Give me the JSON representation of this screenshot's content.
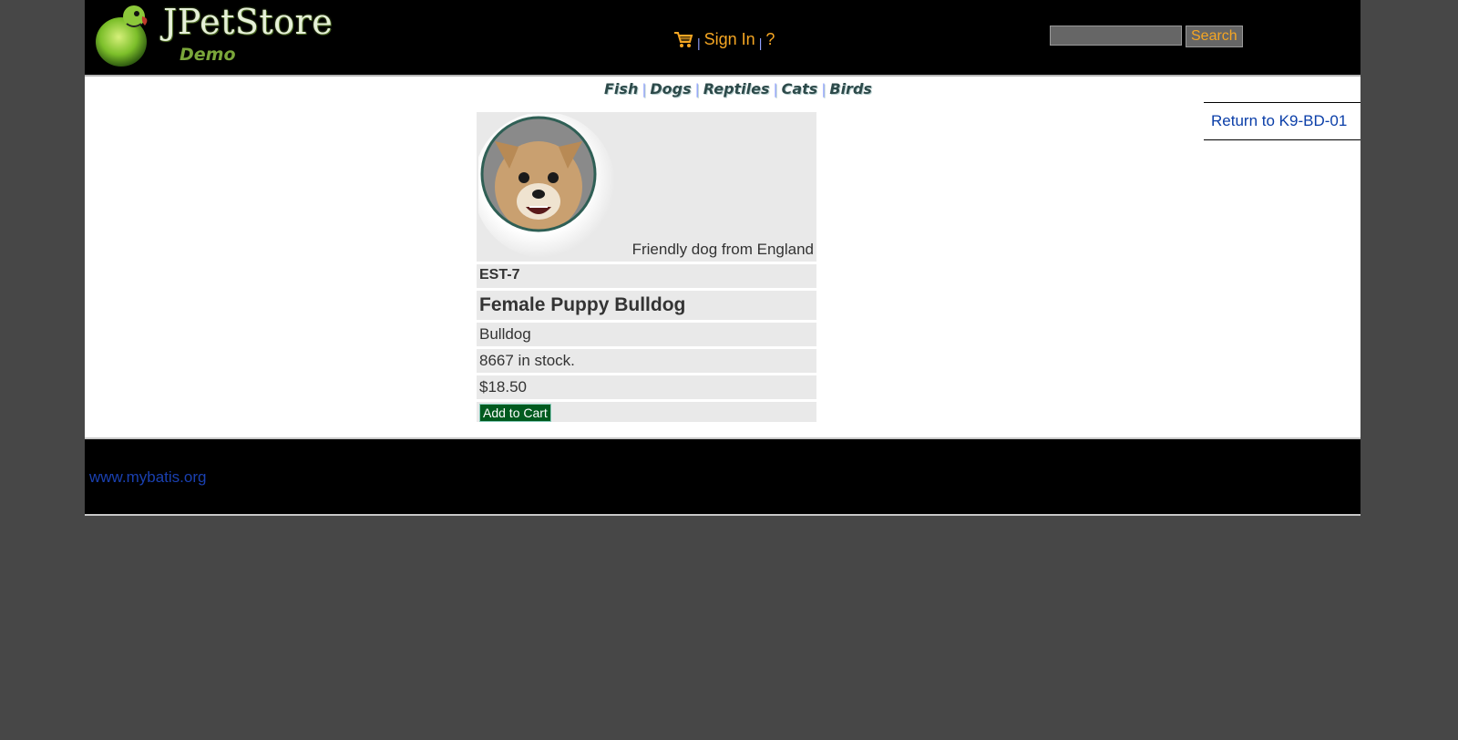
{
  "header": {
    "logo_title": "JPetStore",
    "logo_subtitle": "Demo",
    "menu": {
      "sign_in": "Sign In",
      "help": "?",
      "separator": "|"
    },
    "search": {
      "input_value": "",
      "button_label": "Search"
    }
  },
  "quicklinks": [
    "Fish",
    "Dogs",
    "Reptiles",
    "Cats",
    "Birds"
  ],
  "back_link": "Return to K9-BD-01",
  "item": {
    "description": "Friendly dog from England",
    "id": "EST-7",
    "name": "Female Puppy Bulldog",
    "product": "Bulldog",
    "stock": "8667 in stock.",
    "price": "$18.50",
    "add_to_cart": "Add to Cart"
  },
  "footer": {
    "link": "www.mybatis.org"
  },
  "colors": {
    "page_bg": "#474747",
    "header_bg": "#000000",
    "menu_link": "#f5a623",
    "content_link": "#0a3ea8",
    "add_button": "#005a1e"
  }
}
